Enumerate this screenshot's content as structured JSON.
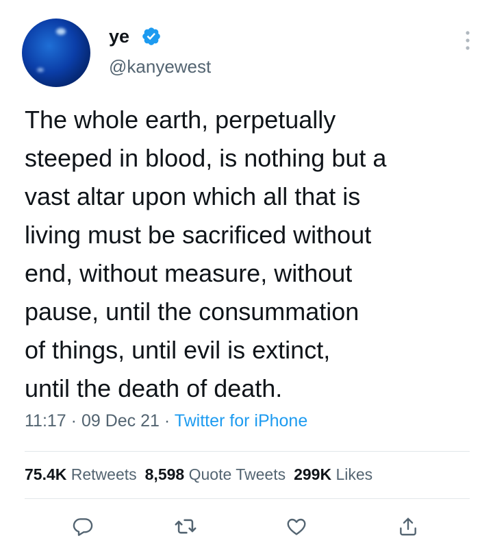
{
  "author": {
    "display_name": "ye",
    "handle": "@kanyewest",
    "verified": true
  },
  "tweet": {
    "lines": [
      "The whole earth, perpetually",
      "steeped in blood, is nothing but a",
      "vast altar upon which all that is",
      "living must be sacrificed without",
      "end, without measure, without",
      "pause, until the consummation",
      "of things, until evil is extinct,",
      "until the death of death."
    ],
    "time": "11:17",
    "separator": "·",
    "date": "09 Dec 21",
    "source": "Twitter for iPhone"
  },
  "stats": {
    "retweets_count": "75.4K",
    "retweets_label": "Retweets",
    "quotes_count": "8,598",
    "quotes_label": "Quote Tweets",
    "likes_count": "299K",
    "likes_label": "Likes"
  },
  "actions": [
    "reply-icon",
    "retweet-icon",
    "like-icon",
    "share-icon"
  ],
  "colors": {
    "text": "#0f1419",
    "secondary": "#536471",
    "accent": "#1d9bf0",
    "divider": "#e1e6ea"
  }
}
